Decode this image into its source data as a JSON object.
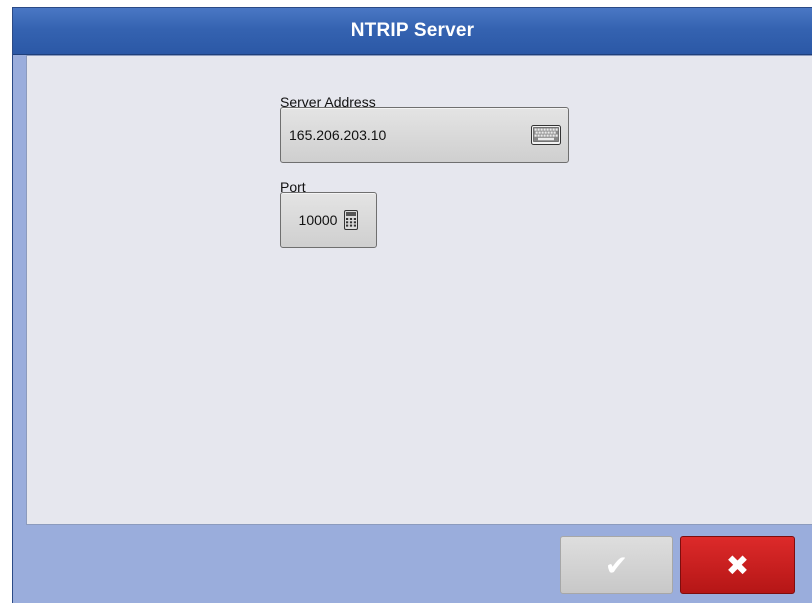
{
  "dialog": {
    "title": "NTRIP Server"
  },
  "fields": {
    "server_address": {
      "label": "Server Address",
      "value": "165.206.203.10",
      "icon": "keyboard-icon"
    },
    "port": {
      "label": "Port",
      "value": "10000",
      "icon": "calculator-icon"
    }
  },
  "actions": {
    "confirm": {
      "symbol": "✔",
      "icon": "checkmark-icon",
      "enabled": false
    },
    "cancel": {
      "symbol": "✖",
      "icon": "close-icon",
      "enabled": true
    }
  },
  "colors": {
    "title_bar": "#3563b1",
    "frame": "#9aaddc",
    "content_bg": "#e6e7ee",
    "cancel": "#c81e1e",
    "confirm_disabled": "#d4d4d4"
  }
}
